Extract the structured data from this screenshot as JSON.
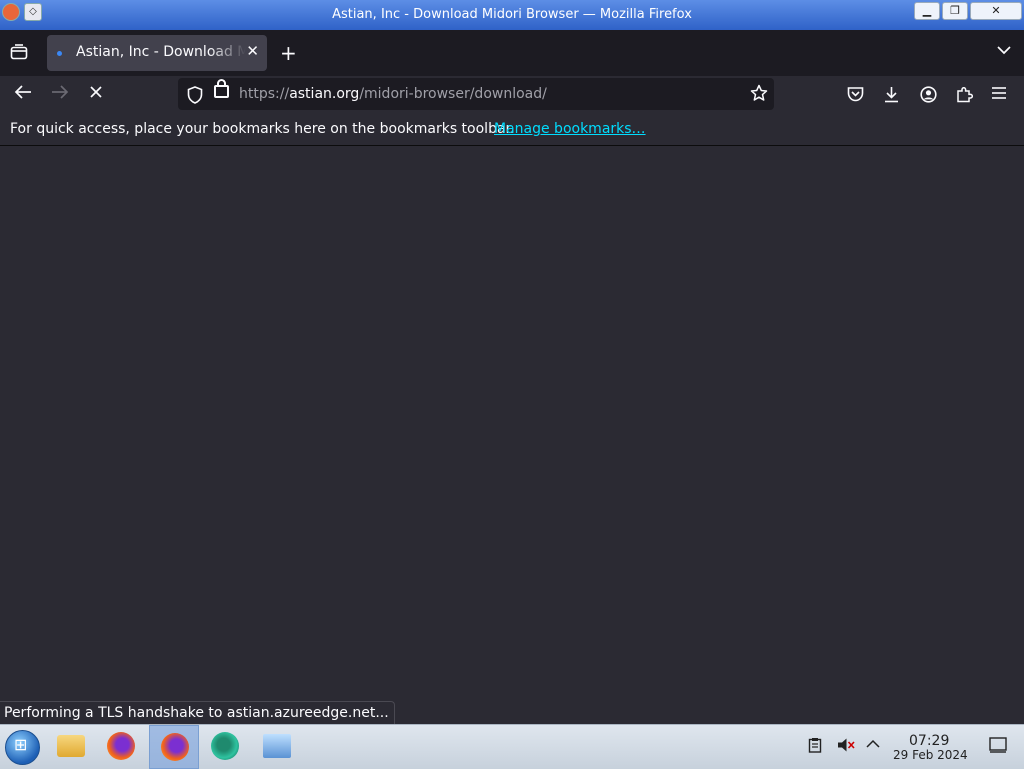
{
  "window": {
    "title": "Astian, Inc - Download Midori Browser — Mozilla Firefox"
  },
  "tab": {
    "title": "Astian, Inc - Download Midori Browser"
  },
  "url": {
    "scheme": "https://",
    "host": "astian.org",
    "path": "/midori-browser/download/"
  },
  "bookmarks_bar": {
    "message": "For quick access, place your bookmarks here on the bookmarks toolbar.",
    "link": "Manage bookmarks…"
  },
  "status_text": "Performing a TLS handshake to astian.azureedge.net...",
  "clock": {
    "time": "07:29",
    "date": "29 Feb 2024"
  },
  "icons": {
    "firefox_view": "firefox-view-icon",
    "new_tab": "plus-icon",
    "list_tabs": "chevron-down-icon",
    "back": "arrow-left-icon",
    "forward": "arrow-right-icon",
    "stop": "close-icon",
    "tracking": "shield-icon",
    "lock": "lock-icon",
    "bookmark": "star-icon",
    "pocket": "pocket-icon",
    "downloads": "download-icon",
    "account": "account-icon",
    "extensions": "puzzle-icon",
    "menu": "hamburger-icon"
  },
  "colors": {
    "accent_link": "#00ddff",
    "toolbar": "#2b2a33",
    "frame": "#1c1b22",
    "favicon": "#3b88f5",
    "titlebar": "#2f62c8"
  }
}
